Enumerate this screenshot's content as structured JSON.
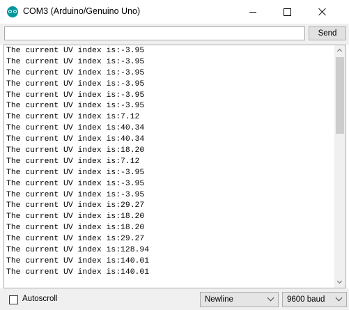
{
  "window": {
    "title": "COM3 (Arduino/Genuino Uno)"
  },
  "toolbar": {
    "input_value": "",
    "send_label": "Send"
  },
  "monitor": {
    "lines": [
      "The current UV index is:-3.95",
      "The current UV index is:-3.95",
      "The current UV index is:-3.95",
      "The current UV index is:-3.95",
      "The current UV index is:-3.95",
      "The current UV index is:-3.95",
      "The current UV index is:7.12",
      "The current UV index is:40.34",
      "The current UV index is:40.34",
      "The current UV index is:18.20",
      "The current UV index is:7.12",
      "The current UV index is:-3.95",
      "The current UV index is:-3.95",
      "The current UV index is:-3.95",
      "The current UV index is:29.27",
      "The current UV index is:18.20",
      "The current UV index is:18.20",
      "The current UV index is:29.27",
      "The current UV index is:128.94",
      "The current UV index is:140.01",
      "The current UV index is:140.01"
    ]
  },
  "statusbar": {
    "autoscroll_label": "Autoscroll",
    "autoscroll_checked": false,
    "line_ending": "Newline",
    "baud_rate": "9600 baud"
  },
  "icons": {
    "app": "arduino-icon",
    "minimize": "minimize-icon",
    "maximize": "maximize-icon",
    "close": "close-icon"
  },
  "colors": {
    "arduino_teal": "#00979c",
    "chrome_bg": "#f0f0f0"
  }
}
